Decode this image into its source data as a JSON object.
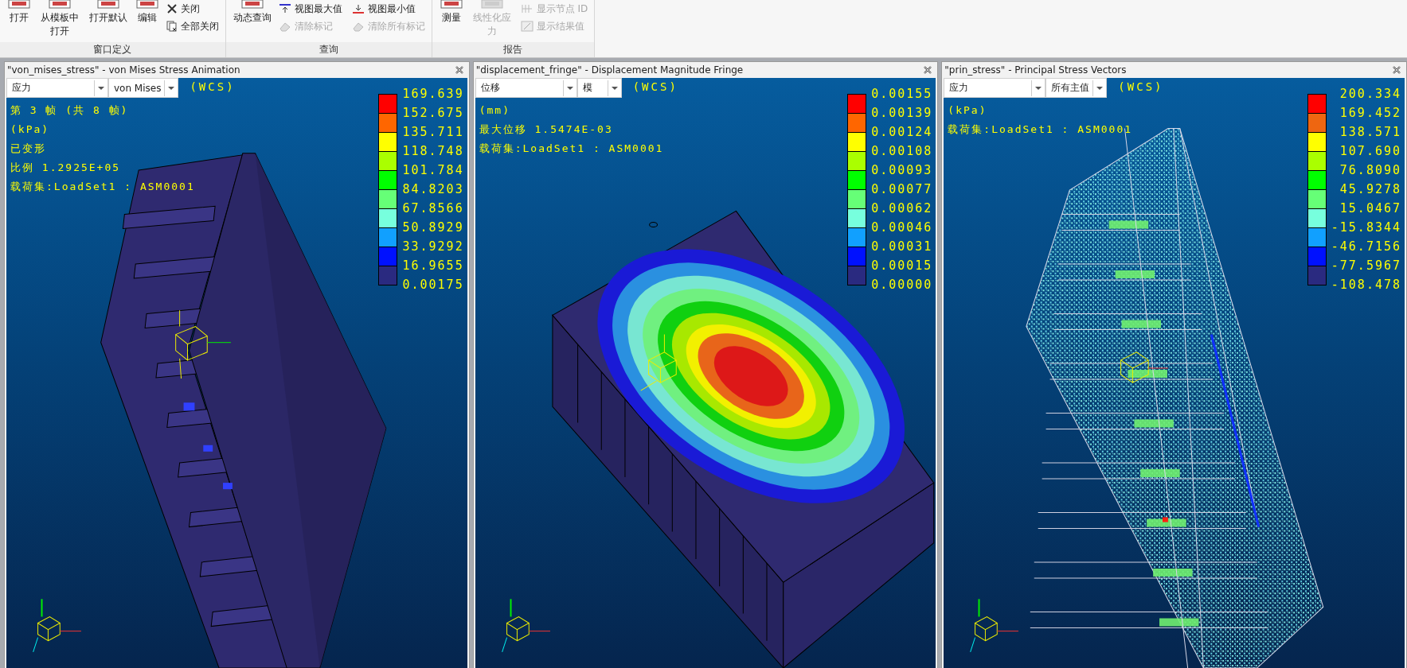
{
  "ribbon": {
    "groups": [
      {
        "label": "窗口定义",
        "buttons": [
          {
            "label": "打开",
            "disabled": false
          },
          {
            "label": "从模板中打开",
            "disabled": false
          },
          {
            "label": "打开默认",
            "disabled": false
          },
          {
            "label": "编辑",
            "disabled": false
          }
        ],
        "small_buttons": [
          {
            "label": "关闭",
            "disabled": false
          },
          {
            "label": "全部关闭",
            "disabled": false
          }
        ]
      },
      {
        "label": "查询",
        "buttons": [
          {
            "label": "动态查询",
            "disabled": false
          }
        ],
        "small_buttons": [
          {
            "label": "视图最大值",
            "disabled": false
          },
          {
            "label": "清除标记",
            "disabled": true
          },
          {
            "label": "视图最小值",
            "disabled": false
          },
          {
            "label": "清除所有标记",
            "disabled": true
          }
        ]
      },
      {
        "label": "报告",
        "buttons": [
          {
            "label": "测量",
            "disabled": false
          },
          {
            "label": "线性化应力",
            "disabled": true
          }
        ],
        "small_buttons": [
          {
            "label": "显示节点 ID",
            "disabled": true
          },
          {
            "label": "显示结果值",
            "disabled": true
          }
        ]
      }
    ]
  },
  "panels": [
    {
      "title": "\"von_mises_stress\" - von Mises Stress Animation",
      "dropdowns": [
        {
          "value": "应力"
        },
        {
          "value": "von Mises"
        }
      ],
      "csys": "(WCS)",
      "info": [
        "第 3 帧 (共 8 帧)",
        "(kPa)",
        "已变形",
        "比例  1.2925E+05",
        "载荷集:LoadSet1 :  ASM0001"
      ],
      "legend": {
        "labels": [
          "169.639",
          "152.675",
          "135.711",
          "118.748",
          "101.784",
          "84.8203",
          "67.8566",
          "50.8929",
          "33.9292",
          "16.9655",
          "0.00175"
        ],
        "bins": [
          {
            "color": "#ff0000"
          },
          {
            "color": "#ff6600"
          },
          {
            "color": "#ffff00"
          },
          {
            "color": "#aaff00"
          },
          {
            "color": "#00ff00"
          },
          {
            "color": "#66ff77"
          },
          {
            "color": "#77ffdd"
          },
          {
            "color": "#11a0ff"
          },
          {
            "color": "#0011ff"
          },
          {
            "color": "#2a2a80"
          }
        ]
      }
    },
    {
      "title": "\"displacement_fringe\" - Displacement Magnitude Fringe",
      "dropdowns": [
        {
          "value": "位移"
        },
        {
          "value": "模"
        }
      ],
      "csys": "(WCS)",
      "info": [
        "(mm)",
        "最大位移  1.5474E-03",
        "载荷集:LoadSet1 :  ASM0001"
      ],
      "legend": {
        "labels": [
          "0.00155",
          "0.00139",
          "0.00124",
          "0.00108",
          "0.00093",
          "0.00077",
          "0.00062",
          "0.00046",
          "0.00031",
          "0.00015",
          "0.00000"
        ],
        "bins": [
          {
            "color": "#ff0000"
          },
          {
            "color": "#ff6600"
          },
          {
            "color": "#ffff00"
          },
          {
            "color": "#aaff00"
          },
          {
            "color": "#00ff00"
          },
          {
            "color": "#66ff77"
          },
          {
            "color": "#77ffdd"
          },
          {
            "color": "#11a0ff"
          },
          {
            "color": "#0011ff"
          },
          {
            "color": "#2a2a80"
          }
        ]
      }
    },
    {
      "title": "\"prin_stress\" - Principal Stress Vectors",
      "dropdowns": [
        {
          "value": "应力"
        },
        {
          "value": "所有主值"
        }
      ],
      "csys": "(WCS)",
      "info": [
        "(kPa)",
        "载荷集:LoadSet1 :  ASM0001"
      ],
      "legend": {
        "labels": [
          "200.334",
          "169.452",
          "138.571",
          "107.690",
          "76.8090",
          "45.9278",
          "15.0467",
          "-15.8344",
          "-46.7156",
          "-77.5967",
          "-108.478"
        ],
        "bins": [
          {
            "color": "#ff0000"
          },
          {
            "color": "#ee6611"
          },
          {
            "color": "#ffff00"
          },
          {
            "color": "#aaff00"
          },
          {
            "color": "#00ff00"
          },
          {
            "color": "#66ff77"
          },
          {
            "color": "#77ffdd"
          },
          {
            "color": "#11a0ff"
          },
          {
            "color": "#0011ff"
          },
          {
            "color": "#2a2a80"
          }
        ]
      }
    }
  ]
}
